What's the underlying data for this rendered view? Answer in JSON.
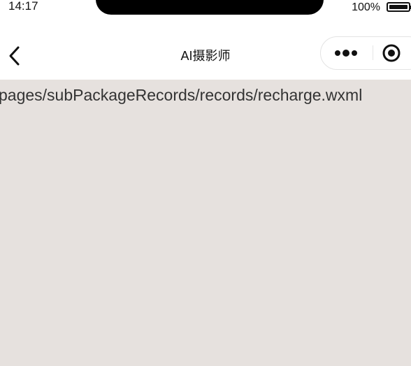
{
  "status_bar": {
    "time": "14:17",
    "battery_percent": "100%",
    "battery_level": 1.0
  },
  "nav": {
    "title": "AI摄影师",
    "back_icon": "chevron-left-icon",
    "more_icon": "more-dots-icon",
    "close_icon": "target-circle-icon"
  },
  "page": {
    "path_text": "pages/subPackageRecords/records/recharge.wxml",
    "background_color": "#e6e1de"
  }
}
